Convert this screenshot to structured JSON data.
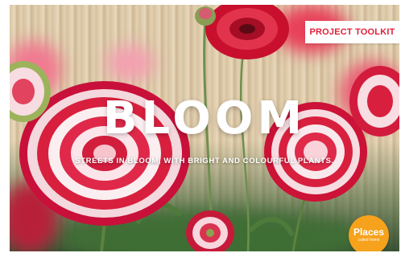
{
  "tag": {
    "label": "PROJECT TOOLKIT"
  },
  "hero": {
    "title": "BLOOM",
    "subtitle": "STREETS IN BLOOM, WITH BRIGHT AND COLOURFUL PLANTS."
  },
  "badge": {
    "title": "Places",
    "subtitle": "called home"
  },
  "colors": {
    "tag_text": "#e0203a",
    "badge_bg": "#f6a21d",
    "petal_red": "#d8203e",
    "petal_white": "#fbeef0"
  }
}
